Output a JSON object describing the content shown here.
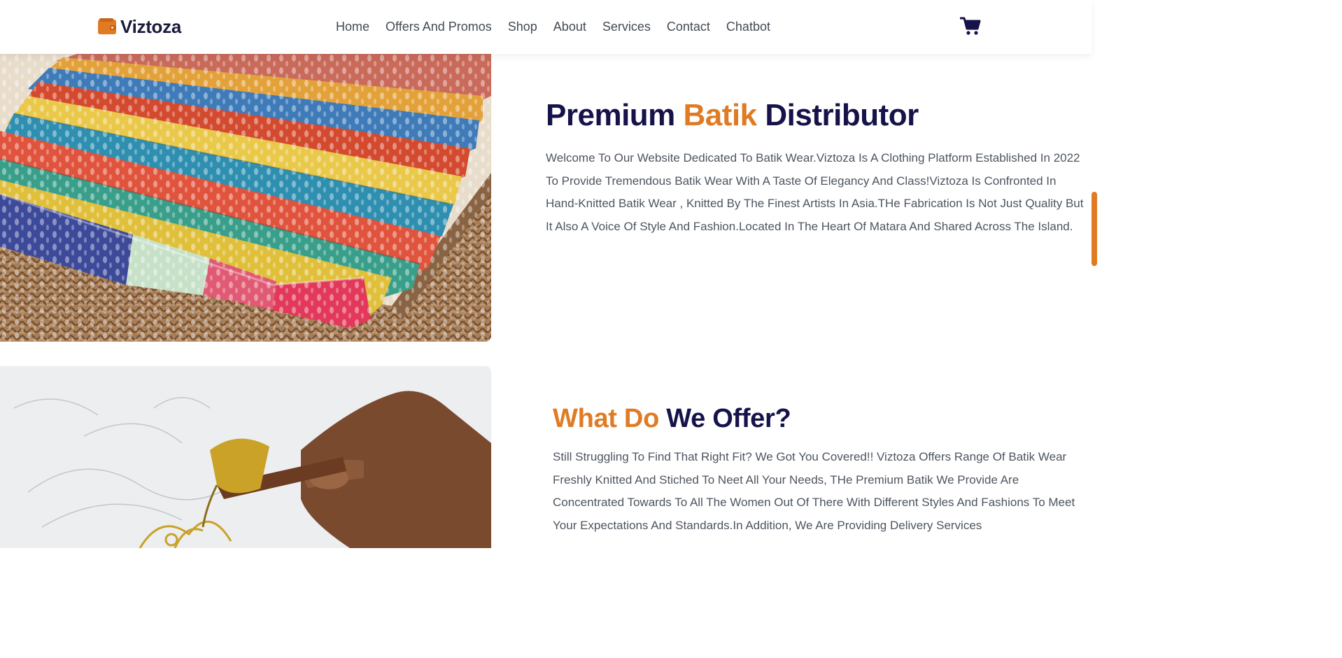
{
  "brand": {
    "name": "Viztoza",
    "accent_color": "#e07b24",
    "heading_color": "#15134a",
    "logo_icon": "wallet-icon"
  },
  "nav": {
    "items": [
      {
        "label": "Home"
      },
      {
        "label": "Offers And Promos"
      },
      {
        "label": "Shop"
      },
      {
        "label": "About"
      },
      {
        "label": "Services"
      },
      {
        "label": "Contact"
      },
      {
        "label": "Chatbot"
      }
    ],
    "cart_icon": "cart-icon"
  },
  "about": {
    "title_part1": "Premium",
    "title_accent": "Batik",
    "title_part2": "Distributor",
    "paragraph": "Welcome To Our Website Dedicated To Batik Wear.Viztoza Is A Clothing Platform Established In 2022 To Provide Tremendous Batik Wear With A Taste Of Elegancy And Class!Viztoza Is Confronted In Hand-Knitted Batik Wear , Knitted By The Finest Artists In Asia.THe Fabrication Is Not Just Quality But It Also A Voice Of Style And Fashion.Located In The Heart Of Matara And Shared Across The Island."
  },
  "offer": {
    "title_accent": "What Do",
    "title_rest": "We Offer?",
    "paragraph": "Still Struggling To Find That Right Fit? We Got You Covered!! Viztoza Offers Range Of Batik Wear Freshly Knitted And Stiched To Neet All Your Needs, THe Premium Batik We Provide Are Concentrated Towards To All The Women Out Of There With Different Styles And Fashions To Meet Your Expectations And Standards.In Addition, We Are Providing Delivery Services"
  }
}
